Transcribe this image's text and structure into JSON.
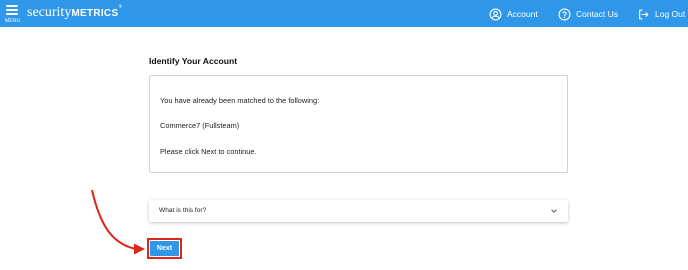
{
  "header": {
    "menu_label": "MENU",
    "logo_light": "security",
    "logo_bold": "METRICS",
    "logo_reg": "®",
    "nav": [
      {
        "label": "Account",
        "icon": "account-circle-icon"
      },
      {
        "label": "Contact Us",
        "icon": "help-circle-icon"
      },
      {
        "label": "Log Out",
        "icon": "logout-icon"
      }
    ]
  },
  "main": {
    "title": "Identify Your Account",
    "card": {
      "line1": "You have already been matched to the following:",
      "line2": "Commerce7 (Fullsteam)",
      "line3": "Please click Next to continue."
    },
    "accordion": {
      "label": "What is this for?",
      "icon": "chevron-down-icon"
    },
    "next_label": "Next"
  },
  "colors": {
    "header_bg": "#2f97ea",
    "button_bg": "#2f97ea",
    "annotation_red": "#e0261b"
  }
}
